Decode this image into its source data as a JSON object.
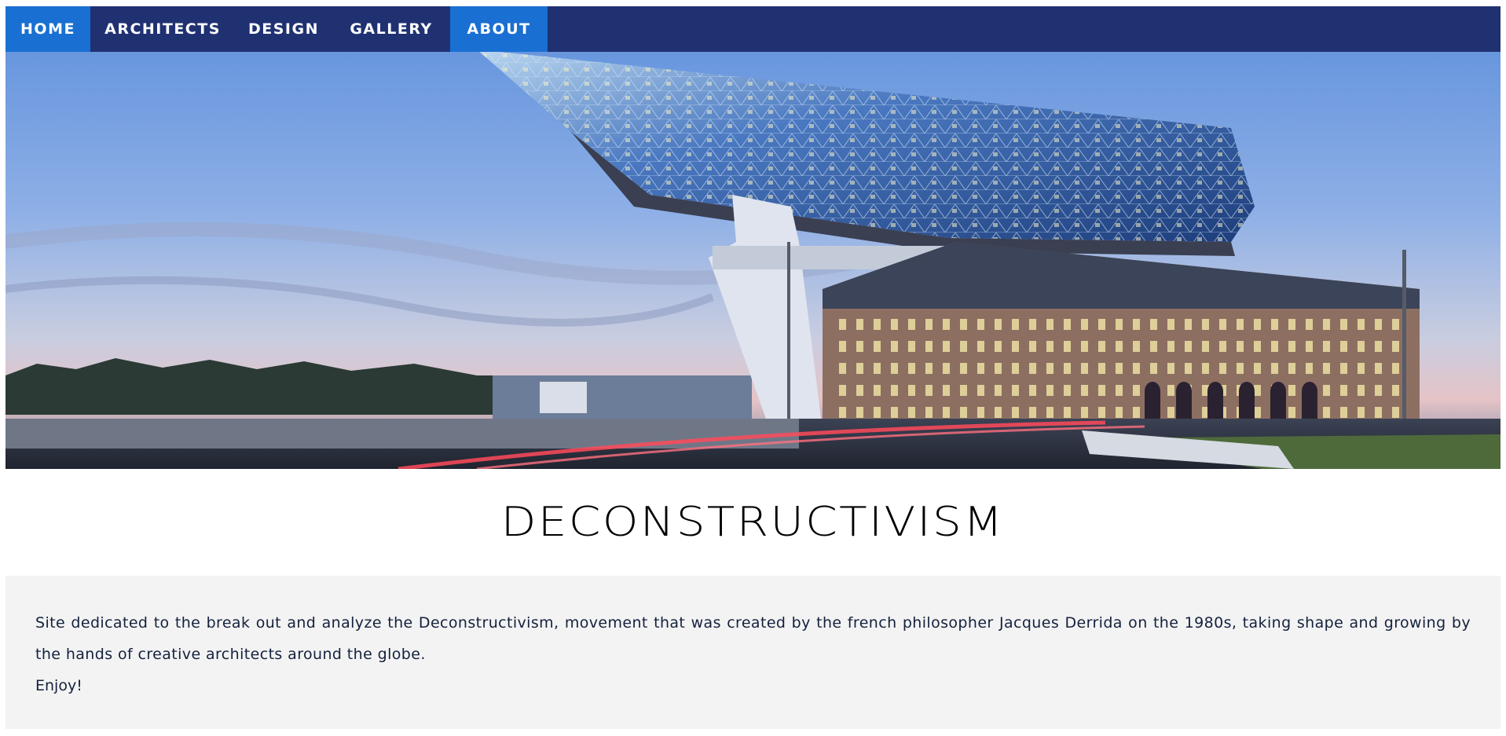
{
  "nav": {
    "items": [
      {
        "label": "HOME",
        "active": true
      },
      {
        "label": "ARCHITECTS",
        "active": false
      },
      {
        "label": "DESIGN",
        "active": false
      },
      {
        "label": "GALLERY",
        "active": false
      },
      {
        "label": "ABOUT",
        "active": true
      }
    ]
  },
  "hero": {
    "image_subject": "glass-faceted-building-over-historic-port-house-at-dusk"
  },
  "main": {
    "title": "DECONSTRUCTIVISM",
    "intro_text": "Site dedicated to the break out and analyze the Deconstructivism, movement that was created by the french philosopher Jacques Derrida on the 1980s, taking shape and growing by the hands of creative architects around the globe.",
    "closing": "Enjoy!"
  },
  "colors": {
    "navbar": "#1e2d6e",
    "nav_active": "#1a6fd3",
    "intro_background": "#f3f3f3",
    "intro_text": "#14213d"
  }
}
